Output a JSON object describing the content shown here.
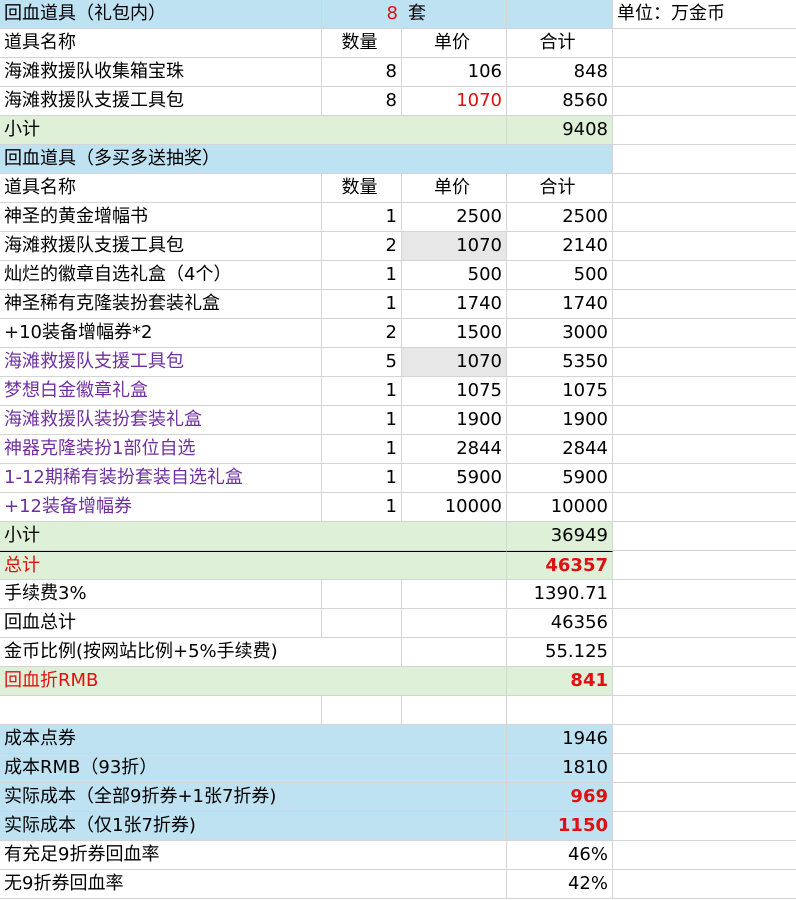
{
  "sheet": {
    "unit_label": "单位：万金币",
    "section1": {
      "title": "回血道具（礼包内）",
      "count": "8",
      "count_unit": "套",
      "headers": [
        "道具名称",
        "数量",
        "单价",
        "合计"
      ],
      "rows": [
        {
          "name": "海滩救援队收集箱宝珠",
          "qty": "8",
          "price": "106",
          "total": "848"
        },
        {
          "name": "海滩救援队支援工具包",
          "qty": "8",
          "price": "1070",
          "total": "8560"
        }
      ],
      "subtotal_label": "小计",
      "subtotal_value": "9408"
    },
    "section2": {
      "title": "回血道具（多买多送抽奖）",
      "headers": [
        "道具名称",
        "数量",
        "单价",
        "合计"
      ],
      "rows": [
        {
          "name": "神圣的黄金增幅书",
          "qty": "1",
          "price": "2500",
          "total": "2500"
        },
        {
          "name": "海滩救援队支援工具包",
          "qty": "2",
          "price": "1070",
          "total": "2140"
        },
        {
          "name": "灿烂的徽章自选礼盒（4个）",
          "qty": "1",
          "price": "500",
          "total": "500"
        },
        {
          "name": "神圣稀有克隆装扮套装礼盒",
          "qty": "1",
          "price": "1740",
          "total": "1740"
        },
        {
          "name": "+10装备增幅券*2",
          "qty": "2",
          "price": "1500",
          "total": "3000"
        },
        {
          "name": "海滩救援队支援工具包",
          "qty": "5",
          "price": "1070",
          "total": "5350"
        },
        {
          "name": "梦想白金徽章礼盒",
          "qty": "1",
          "price": "1075",
          "total": "1075"
        },
        {
          "name": "海滩救援队装扮套装礼盒",
          "qty": "1",
          "price": "1900",
          "total": "1900"
        },
        {
          "name": "神器克隆装扮1部位自选",
          "qty": "1",
          "price": "2844",
          "total": "2844"
        },
        {
          "name": "1-12期稀有装扮套装自选礼盒",
          "qty": "1",
          "price": "5900",
          "total": "5900"
        },
        {
          "name": "+12装备增幅券",
          "qty": "1",
          "price": "10000",
          "total": "10000"
        }
      ],
      "subtotal_label": "小计",
      "subtotal_value": "36949"
    },
    "summary": {
      "total_label": "总计",
      "total_value": "46357",
      "fee_label": "手续费3%",
      "fee_value": "1390.71",
      "net_label": "回血总计",
      "net_value": "46356",
      "ratio_label": "金币比例(按网站比例+5%手续费)",
      "ratio_value": "55.125",
      "rmb_label": "回血折RMB",
      "rmb_value": "841"
    },
    "cost": {
      "points_label": "成本点券",
      "points_value": "1946",
      "rmb_label": "成本RMB（93折）",
      "rmb_value": "1810",
      "actual1_label": "实际成本（全部9折券+1张7折券)",
      "actual1_value": "969",
      "actual2_label": "实际成本（仅1张7折券)",
      "actual2_value": "1150",
      "rate1_label": "有充足9折券回血率",
      "rate1_value": "46%",
      "rate2_label": "无9折券回血率",
      "rate2_value": "42%"
    }
  }
}
